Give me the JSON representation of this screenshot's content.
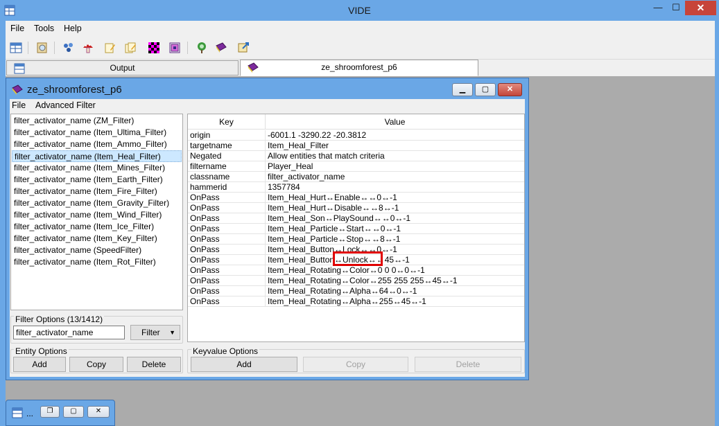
{
  "app": {
    "title": "VIDE",
    "close_glyph": "✕",
    "min_glyph": "—",
    "max_glyph": "☐"
  },
  "menu": [
    "File",
    "Tools",
    "Help"
  ],
  "toolbar_icons": [
    "grid-icon",
    "search-icon",
    "entities-icon",
    "mushroom-icon",
    "edit-icon",
    "edit-copy-icon",
    "checker-icon",
    "layers-icon",
    "tree-icon",
    "book-icon",
    "export-icon"
  ],
  "tabs": [
    {
      "label": "Output",
      "active": false
    },
    {
      "label": "ze_shroomforest_p6",
      "active": true
    }
  ],
  "child": {
    "title": "ze_shroomforest_p6",
    "menu": [
      "File",
      "Advanced Filter"
    ],
    "entities": [
      "filter_activator_name (ZM_Filter)",
      "filter_activator_name (Item_Ultima_Filter)",
      "filter_activator_name (Item_Ammo_Filter)",
      "filter_activator_name (Item_Heal_Filter)",
      "filter_activator_name (Item_Mines_Filter)",
      "filter_activator_name (Item_Earth_Filter)",
      "filter_activator_name (Item_Fire_Filter)",
      "filter_activator_name (Item_Gravity_Filter)",
      "filter_activator_name (Item_Wind_Filter)",
      "filter_activator_name (Item_Ice_Filter)",
      "filter_activator_name (Item_Key_Filter)",
      "filter_activator_name (SpeedFilter)",
      "filter_activator_name (Item_Rot_Filter)"
    ],
    "selected_index": 3,
    "filter_options": {
      "label": "Filter Options (13/1412)",
      "value": "filter_activator_name",
      "button": "Filter",
      "arrow": "▼"
    },
    "entity_options": {
      "label": "Entity Options",
      "add": "Add",
      "copy": "Copy",
      "delete": "Delete"
    },
    "keyvalues": {
      "headers": [
        "Key",
        "Value"
      ],
      "rows": [
        [
          "origin",
          "-6001.1 -3290.22 -20.3812"
        ],
        [
          "targetname",
          "Item_Heal_Filter"
        ],
        [
          "Negated",
          "Allow entities that match criteria"
        ],
        [
          "filtername",
          "Player_Heal"
        ],
        [
          "classname",
          "filter_activator_name"
        ],
        [
          "hammerid",
          "1357784"
        ],
        [
          "OnPass",
          "Item_Heal_Hurt↔Enable↔↔0↔-1"
        ],
        [
          "OnPass",
          "Item_Heal_Hurt↔Disable↔↔8↔-1"
        ],
        [
          "OnPass",
          "Item_Heal_Son↔PlaySound↔↔0↔-1"
        ],
        [
          "OnPass",
          "Item_Heal_Particle↔Start↔↔0↔-1"
        ],
        [
          "OnPass",
          "Item_Heal_Particle↔Stop↔↔8↔-1"
        ],
        [
          "OnPass",
          "Item_Heal_Button↔Lock↔↔0↔-1"
        ],
        [
          "OnPass",
          "Item_Heal_Button↔Unlock↔↔45↔-1"
        ],
        [
          "OnPass",
          "Item_Heal_Rotating↔Color↔0 0 0↔0↔-1"
        ],
        [
          "OnPass",
          "Item_Heal_Rotating↔Color↔255 255 255↔45↔-1"
        ],
        [
          "OnPass",
          "Item_Heal_Rotating↔Alpha↔64↔0↔-1"
        ],
        [
          "OnPass",
          "Item_Heal_Rotating↔Alpha↔255↔45↔-1"
        ]
      ]
    },
    "keyvalue_options": {
      "label": "Keyvalue Options",
      "add": "Add",
      "copy": "Copy",
      "delete": "Delete"
    }
  },
  "minimized": {
    "label": "..."
  },
  "colors": {
    "title_bar": "#6aa7e6",
    "close_red": "#c7443a",
    "highlight_red": "#e00000",
    "selection": "#cde8ff"
  }
}
